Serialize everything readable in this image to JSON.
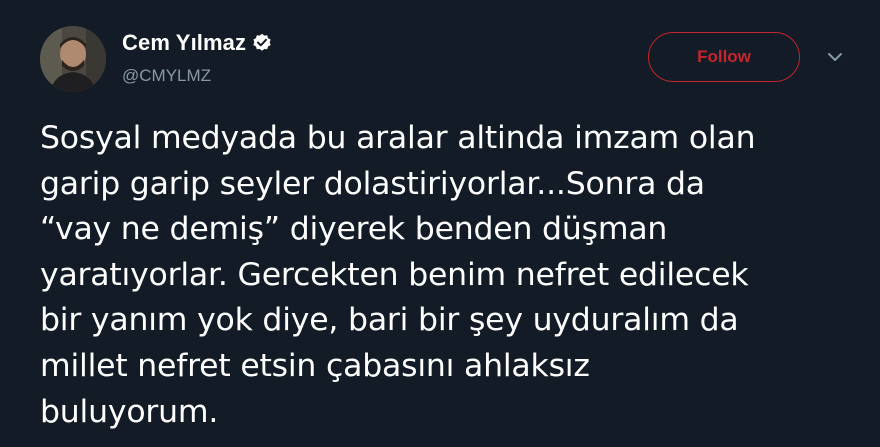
{
  "author": {
    "display_name": "Cem Yılmaz",
    "handle": "@CMYLMZ",
    "verified": true
  },
  "actions": {
    "follow_label": "Follow"
  },
  "tweet": {
    "text": "Sosyal medyada bu aralar altinda imzam olan\ngarip garip seyler dolastiriyorlar...Sonra da\n“vay ne demiş” diyerek benden düşman\nyaratıyorlar. Gercekten benim nefret edilecek\nbir yanım yok diye, bari bir şey uyduralım da\nmillet nefret etsin çabasını ahlaksız\nbuluyorum."
  },
  "icons": {
    "verified": "verified-badge-icon",
    "more": "chevron-down-icon"
  },
  "colors": {
    "background": "#121b26",
    "accent": "#c4262d",
    "secondary_text": "#8899a6",
    "primary_text": "#ffffff"
  }
}
